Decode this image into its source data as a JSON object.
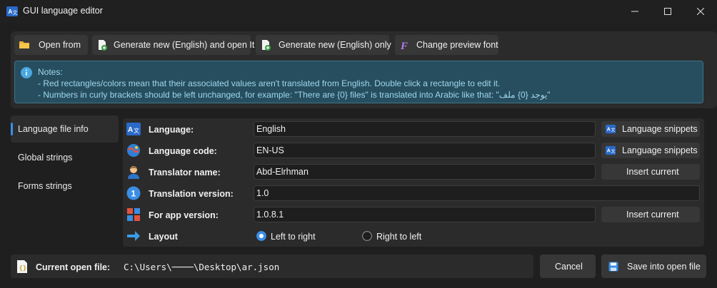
{
  "window": {
    "title": "GUI language editor",
    "app_icon": "translate-icon",
    "controls": [
      "minimize-icon",
      "maximize-icon",
      "close-icon"
    ]
  },
  "toolbar": {
    "open_from": "Open from",
    "generate_open": "Generate new (English) and open It",
    "generate_only": "Generate new (English) only",
    "change_font": "Change preview font"
  },
  "notes": {
    "line1": "Notes:",
    "line2": "- Red rectangles/colors mean that their associated values aren't translated from English. Double click a rectangle to edit it.",
    "line3": "- Numbers in curly brackets should be left unchanged, for example: \"There are {0} files\" is translated into Arabic like that: \"يوجد {0} ملف\""
  },
  "sidebar": {
    "items": [
      {
        "label": "Language file info",
        "active": true
      },
      {
        "label": "Global strings",
        "active": false
      },
      {
        "label": "Forms strings",
        "active": false
      }
    ]
  },
  "form": {
    "language": {
      "label": "Language:",
      "value": "English",
      "button": "Language snippets"
    },
    "language_code": {
      "label": "Language code:",
      "value": "EN-US",
      "button": "Language snippets"
    },
    "translator_name": {
      "label": "Translator name:",
      "value": "Abd-Elrhman",
      "button": "Insert current"
    },
    "translation_version": {
      "label": "Translation version:",
      "value": "1.0"
    },
    "app_version": {
      "label": "For app version:",
      "value": "1.0.8.1",
      "button": "Insert current"
    },
    "layout": {
      "label": "Layout",
      "options": [
        "Left to right",
        "Right to left"
      ],
      "selected": "Left to right"
    }
  },
  "footer": {
    "label": "Current open file:",
    "path": "C:\\Users\\────\\Desktop\\ar.json",
    "cancel": "Cancel",
    "save": "Save into open file"
  },
  "colors": {
    "accent": "#3b8eea",
    "notes_bg": "#274e5f",
    "notes_text": "#9dd8ec",
    "panel": "#2b2b2b",
    "window": "#1f1f1f"
  }
}
